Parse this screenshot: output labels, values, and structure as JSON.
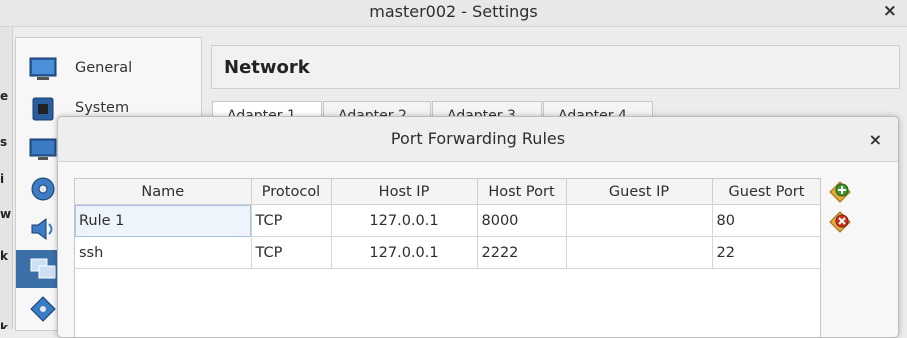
{
  "window": {
    "title": "master002 - Settings",
    "close_glyph": "×"
  },
  "sidebar": {
    "items": [
      {
        "label": "General",
        "icon": "general-icon"
      },
      {
        "label": "System",
        "icon": "system-icon"
      },
      {
        "label": "",
        "icon": "display-icon"
      },
      {
        "label": "",
        "icon": "storage-icon"
      },
      {
        "label": "",
        "icon": "audio-icon"
      },
      {
        "label": "",
        "icon": "network-icon"
      },
      {
        "label": "",
        "icon": "usb-icon"
      }
    ]
  },
  "section": {
    "title": "Network"
  },
  "adapter_tabs": [
    "Adapter 1",
    "Adapter 2",
    "Adapter 3",
    "Adapter 4"
  ],
  "dialog": {
    "title": "Port Forwarding Rules",
    "close_glyph": "×",
    "columns": [
      "Name",
      "Protocol",
      "Host IP",
      "Host Port",
      "Guest IP",
      "Guest Port"
    ],
    "rows": [
      {
        "name": "Rule 1",
        "protocol": "TCP",
        "host_ip": "127.0.0.1",
        "host_port": "8000",
        "guest_ip": "",
        "guest_port": "80"
      },
      {
        "name": "ssh",
        "protocol": "TCP",
        "host_ip": "127.0.0.1",
        "host_port": "2222",
        "guest_ip": "",
        "guest_port": "22"
      }
    ],
    "buttons": [
      "add-rule-icon",
      "remove-rule-icon"
    ]
  },
  "colors": {
    "selection": "#3a6fa8",
    "add_green": "#3c9a2e",
    "remove_red": "#d0301f"
  }
}
